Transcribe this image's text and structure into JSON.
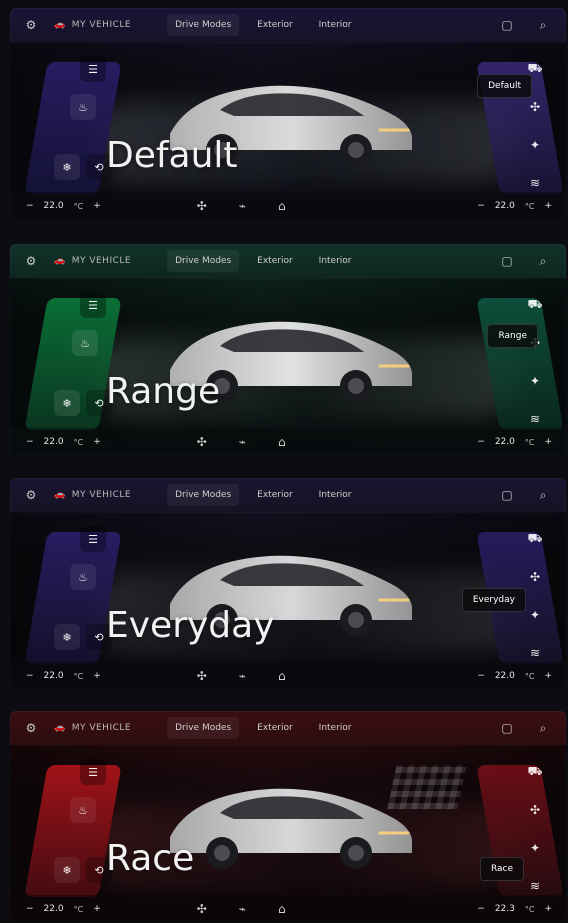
{
  "panels": [
    {
      "id": "default",
      "theme": {
        "accent": "#3b2a7a",
        "left": "#2a1f6a",
        "right": "#3b2a7a"
      },
      "top": {
        "vehicle_label": "MY VEHICLE",
        "tabs": [
          "Drive Modes",
          "Exterior",
          "Interior"
        ],
        "active_tab_index": 0
      },
      "top_icons": [
        "gear-icon",
        "car-icon",
        "panel-icon",
        "search-icon"
      ],
      "stage": {
        "mode_name": "Default",
        "pill_label": "Default"
      },
      "left_controls": [
        "menu-icon",
        "seat-heat-icon",
        "seat-cool-icon",
        "steering-icon"
      ],
      "right_controls": [
        "car-icon",
        "fan-icon",
        "heat-icon",
        "defrost-icon"
      ],
      "bottom": {
        "left_temp": "22.0",
        "left_unit": "°C",
        "right_temp": "22.0",
        "right_unit": "°C",
        "minus": "−",
        "plus": "+",
        "center_icons": [
          "fan-icon",
          "climate-icon",
          "home-icon"
        ]
      }
    },
    {
      "id": "range",
      "theme": {
        "accent": "#0f6a44",
        "left": "#0b7a3a",
        "right": "#0f5a44"
      },
      "top": {
        "vehicle_label": "MY VEHICLE",
        "tabs": [
          "Drive Modes",
          "Exterior",
          "Interior"
        ],
        "active_tab_index": 0
      },
      "top_icons": [
        "gear-icon",
        "car-icon",
        "panel-icon",
        "search-icon"
      ],
      "stage": {
        "mode_name": "Range",
        "pill_label": "Range"
      },
      "left_controls": [
        "menu-icon",
        "seat-heat-icon",
        "seat-cool-icon",
        "steering-icon"
      ],
      "right_controls": [
        "car-icon",
        "fan-icon",
        "heat-icon",
        "defrost-icon"
      ],
      "bottom": {
        "left_temp": "22.0",
        "left_unit": "°C",
        "right_temp": "22.0",
        "right_unit": "°C",
        "minus": "−",
        "plus": "+",
        "center_icons": [
          "fan-icon",
          "climate-icon",
          "home-icon"
        ]
      }
    },
    {
      "id": "everyday",
      "theme": {
        "accent": "#2a1f6a",
        "left": "#2b1f6a",
        "right": "#2a1f6a"
      },
      "top": {
        "vehicle_label": "MY VEHICLE",
        "tabs": [
          "Drive Modes",
          "Exterior",
          "Interior"
        ],
        "active_tab_index": 0
      },
      "top_icons": [
        "gear-icon",
        "car-icon",
        "panel-icon",
        "search-icon"
      ],
      "stage": {
        "mode_name": "Everyday",
        "pill_label": "Everyday"
      },
      "left_controls": [
        "menu-icon",
        "seat-heat-icon",
        "seat-cool-icon",
        "steering-icon"
      ],
      "right_controls": [
        "car-icon",
        "fan-icon",
        "heat-icon",
        "defrost-icon"
      ],
      "bottom": {
        "left_temp": "22.0",
        "left_unit": "°C",
        "right_temp": "22.0",
        "right_unit": "°C",
        "minus": "−",
        "plus": "+",
        "center_icons": [
          "fan-icon",
          "climate-icon",
          "home-icon"
        ]
      }
    },
    {
      "id": "race",
      "theme": {
        "accent": "#b51a1f",
        "left": "#b2141b",
        "right": "#7a1018"
      },
      "top": {
        "vehicle_label": "MY VEHICLE",
        "tabs": [
          "Drive Modes",
          "Exterior",
          "Interior"
        ],
        "active_tab_index": 0
      },
      "top_icons": [
        "gear-icon",
        "car-icon",
        "panel-icon",
        "search-icon"
      ],
      "stage": {
        "mode_name": "Race",
        "pill_label": "Race"
      },
      "left_controls": [
        "menu-icon",
        "seat-heat-icon",
        "seat-cool-icon",
        "steering-icon"
      ],
      "right_controls": [
        "car-icon",
        "fan-icon",
        "heat-icon",
        "defrost-icon"
      ],
      "bottom": {
        "left_temp": "22.0",
        "left_unit": "°C",
        "right_temp": "22.3",
        "right_unit": "°C",
        "minus": "−",
        "plus": "+",
        "center_icons": [
          "fan-icon",
          "climate-icon",
          "home-icon"
        ]
      }
    }
  ]
}
